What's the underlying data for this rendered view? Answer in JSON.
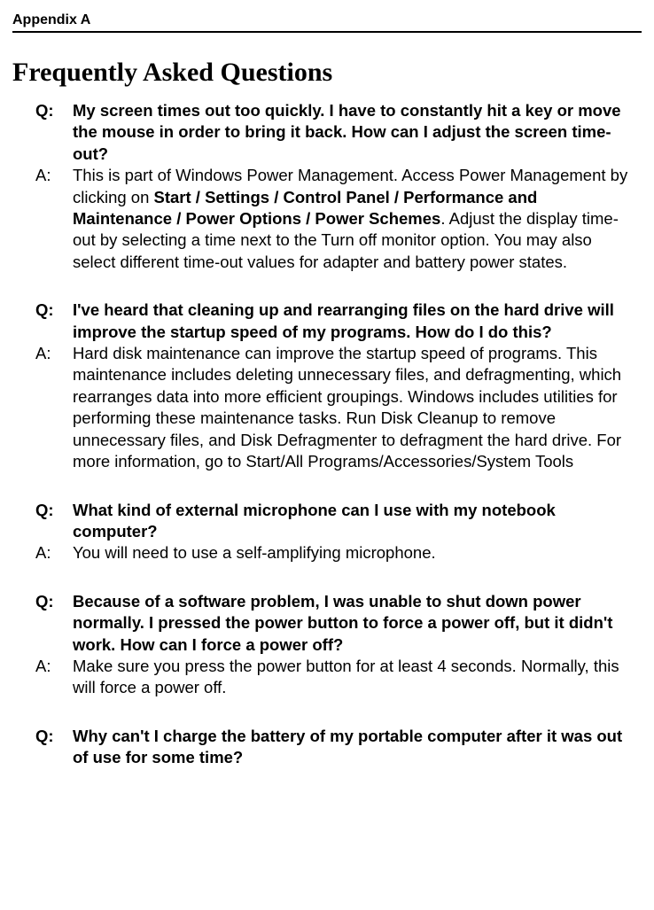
{
  "header": "Appendix A",
  "title": "Frequently Asked Questions",
  "qLabel": "Q:",
  "aLabel": "A:",
  "faq": [
    {
      "q": "My screen times out too quickly. I have to constantly hit a key or move the mouse in order to bring it back. How can I adjust the screen time-out?",
      "a_pre": "This is part of Windows Power Management. Access Power Management by clicking on ",
      "a_bold": "Start / Settings / Control Panel / Performance and Maintenance / Power Options / Power Schemes",
      "a_post": ". Adjust the display time-out by selecting a time next to the Turn off monitor option. You may also select different time-out values for adapter and battery power states."
    },
    {
      "q": "I've heard that cleaning up and rearranging files on the hard drive will improve the startup speed of my programs. How do I do this?",
      "a": "Hard disk maintenance can improve the startup speed of programs. This maintenance includes deleting unnecessary files, and defragmenting, which rearranges data into more efficient groupings. Windows includes utilities for performing these maintenance tasks. Run Disk Cleanup to remove unnecessary files, and Disk Defragmenter to defragment the hard drive. For more information, go to Start/All Programs/Accessories/System Tools"
    },
    {
      "q": "What kind of external microphone can I use with my notebook computer?",
      "a": "You will need to use a self-amplifying microphone."
    },
    {
      "q": "Because of a software problem, I was unable to shut down power normally. I pressed the power button to force a power off, but it didn't work. How can I force a power off?",
      "a": "Make sure you press the power button for at least 4 seconds. Normally, this will force a power off."
    },
    {
      "q": "Why can't I charge the battery of my portable computer after it was out of use for some time?"
    }
  ]
}
